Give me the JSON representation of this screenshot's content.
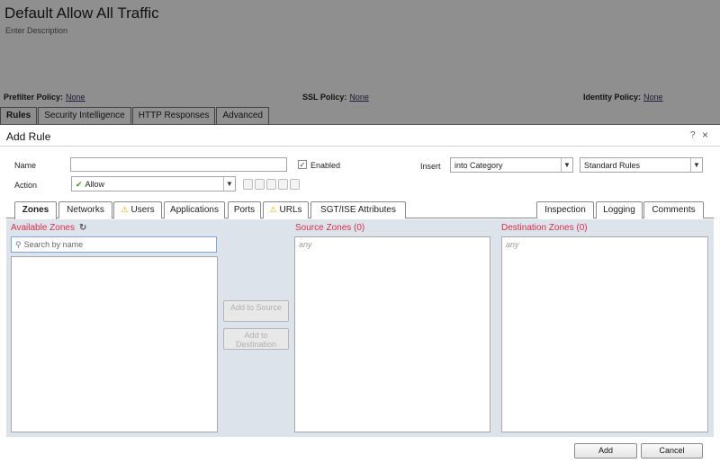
{
  "background": {
    "title": "Default Allow All Traffic",
    "description": "Enter Description",
    "policies": [
      {
        "label": "Prefilter Policy:",
        "value": "None"
      },
      {
        "label": "SSL Policy:",
        "value": "None"
      },
      {
        "label": "Identity Policy:",
        "value": "None"
      }
    ],
    "tabs": [
      "Rules",
      "Security Intelligence",
      "HTTP Responses",
      "Advanced"
    ]
  },
  "modal": {
    "title": "Add Rule",
    "help": "?",
    "close": "×",
    "form": {
      "name_label": "Name",
      "name_value": "",
      "enabled_label": "Enabled",
      "enabled_checked": true,
      "insert_label": "Insert",
      "insert_value": "into Category",
      "category_value": "Standard Rules",
      "action_label": "Action",
      "action_value": "Allow"
    },
    "tabs_left": [
      "Zones",
      "Networks",
      "Users",
      "Applications",
      "Ports",
      "URLs",
      "SGT/ISE Attributes"
    ],
    "tabs_right": [
      "Inspection",
      "Logging",
      "Comments"
    ],
    "zones": {
      "available_title": "Available Zones",
      "search_placeholder": "Search by name",
      "add_to_source": "Add to Source",
      "add_to_destination": "Add to Destination",
      "source_title": "Source Zones (0)",
      "destination_title": "Destination Zones (0)",
      "any": "any"
    },
    "footer": {
      "add": "Add",
      "cancel": "Cancel"
    }
  },
  "colors": {
    "section_title": "#d6304a",
    "content_bg": "#dde3ea"
  }
}
